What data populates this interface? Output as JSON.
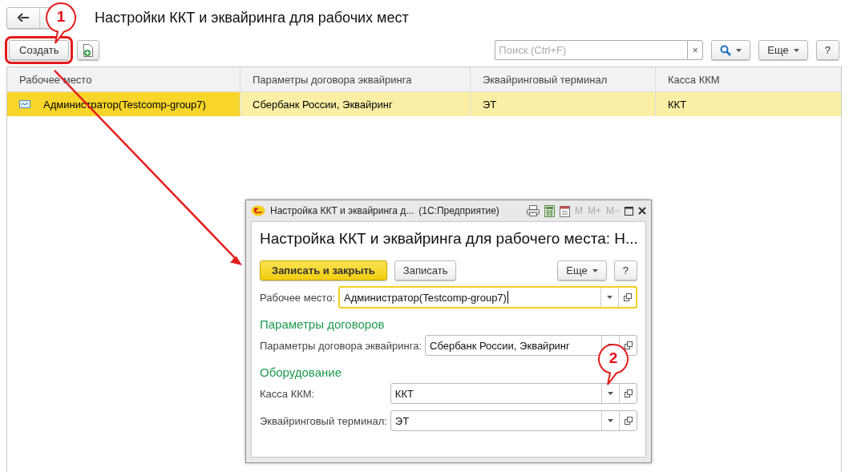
{
  "page": {
    "title": "Настройки ККТ и эквайринга для рабочих мест",
    "favorite": false
  },
  "toolbar": {
    "create_button": {
      "label": "Создать",
      "highlighted": true
    },
    "search": {
      "placeholder": "Поиск (Ctrl+F)"
    },
    "clear_button": "×",
    "more_button": "Еще",
    "help_button": "?"
  },
  "table": {
    "columns": [
      "Рабочее место",
      "Параметры договора эквайринга",
      "Эквайринговый терминал",
      "Касса ККМ"
    ],
    "rows": [
      {
        "cells": [
          "Администратор(Testcomp-group7)",
          "Сбербанк России, Эквайринг",
          "ЭТ",
          "ККТ"
        ],
        "selected": true
      }
    ]
  },
  "dialog": {
    "title": "Настройка ККТ и эквайринга д...",
    "app_name": "(1С:Предприятие)",
    "memory_buttons": [
      "M",
      "M+",
      "M−"
    ],
    "heading": "Настройка ККТ и эквайринга для рабочего места: Н...",
    "buttons": [
      {
        "label": "Записать и закрыть",
        "default": true
      },
      {
        "label": "Записать",
        "default": false
      }
    ],
    "more_button": "Еще",
    "help_button": "?",
    "items": [
      {
        "kind": "field",
        "label": "Рабочее место:",
        "value": "Администратор(Testcomp-group7)",
        "focused": true
      },
      {
        "kind": "section",
        "title": "Параметры договоров"
      },
      {
        "kind": "field",
        "label": "Параметры договора эквайринга:",
        "value": "Сбербанк России, Эквайринг",
        "focused": false
      },
      {
        "kind": "section",
        "title": "Оборудование"
      },
      {
        "kind": "field",
        "label": "Касса ККМ:",
        "value": "ККТ",
        "focused": false
      },
      {
        "kind": "field",
        "label": "Эквайринговый терминал:",
        "value": "ЭТ",
        "focused": false
      }
    ]
  },
  "callouts": [
    {
      "number": "1"
    },
    {
      "number": "2"
    }
  ]
}
